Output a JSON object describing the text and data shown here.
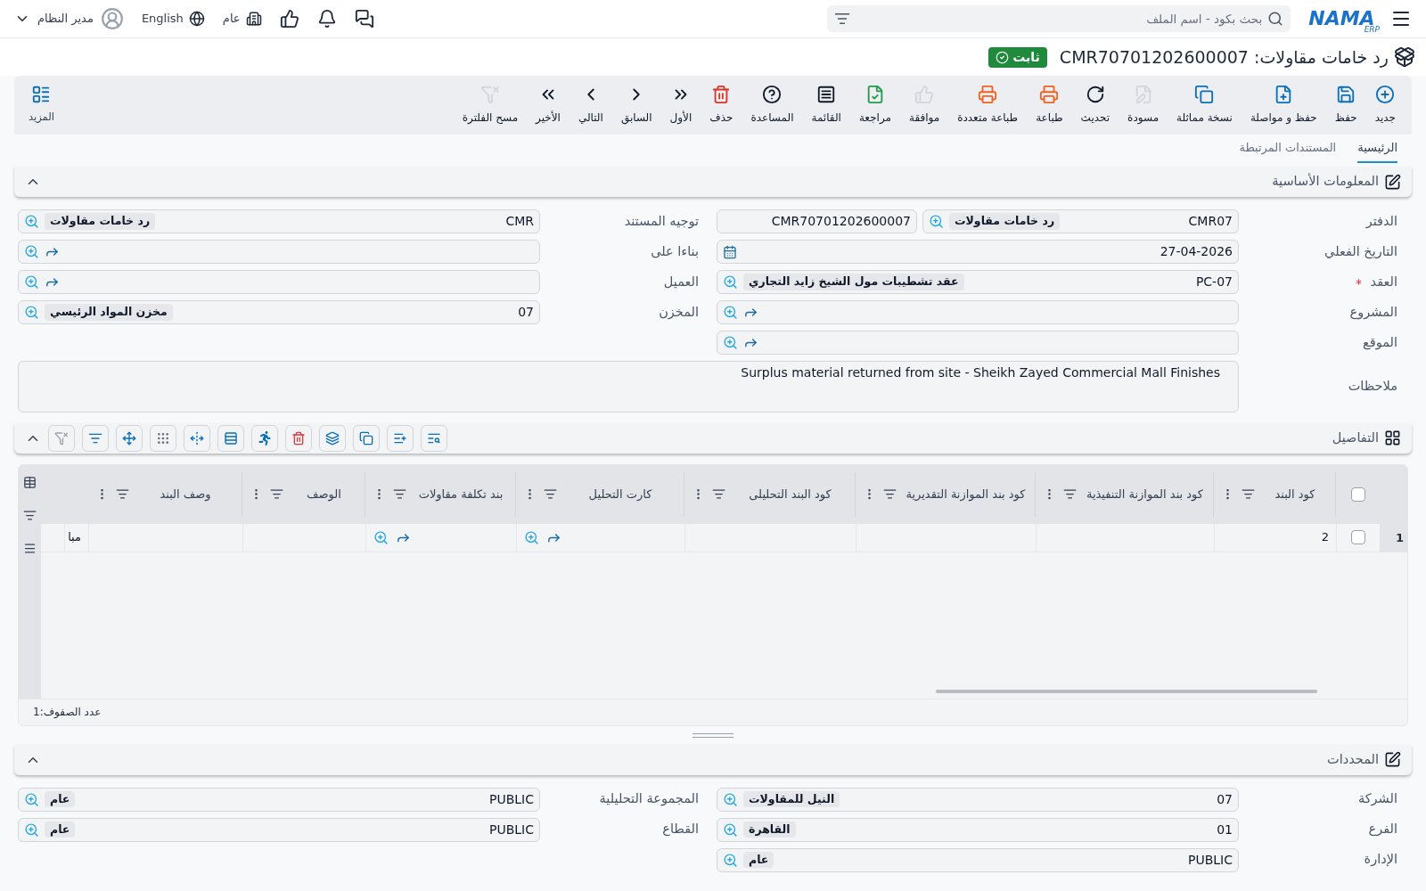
{
  "topbar": {
    "logo": "NAMA",
    "logo_sub": "ERP",
    "search": {
      "placeholder": "بحث بكود - اسم الملف"
    },
    "scope": "عام",
    "language": "English",
    "user": "مدير النظام"
  },
  "document": {
    "title": "رد خامات مقاولات: CMR70701202600007",
    "status": {
      "label": "ثابت",
      "kind": "posted"
    }
  },
  "toolbar": [
    {
      "label": "جديد",
      "disabled": false
    },
    {
      "label": "حفظ",
      "disabled": false
    },
    {
      "label": "حفظ و مواصلة",
      "disabled": false
    },
    {
      "label": "نسخة مماثلة",
      "disabled": false
    },
    {
      "label": "مسودة",
      "disabled": true
    },
    {
      "label": "تحديث",
      "disabled": false
    },
    {
      "label": "طباعة",
      "disabled": false
    },
    {
      "label": "طباعة متعددة",
      "disabled": false
    },
    {
      "label": "موافقة",
      "disabled": true
    },
    {
      "label": "مراجعة",
      "disabled": false
    },
    {
      "label": "القائمة",
      "disabled": false
    },
    {
      "label": "المساعدة",
      "disabled": false
    },
    {
      "label": "حذف",
      "disabled": false
    },
    {
      "label": "الأول",
      "disabled": false
    },
    {
      "label": "السابق",
      "disabled": false
    },
    {
      "label": "التالي",
      "disabled": false
    },
    {
      "label": "الأخير",
      "disabled": false
    },
    {
      "label": "مسح الفلترة",
      "disabled": true
    }
  ],
  "more": "المزيد",
  "tabs": [
    {
      "label": "الرئيسية",
      "selected": true
    },
    {
      "label": "المستندات المرتبطة",
      "selected": false
    }
  ],
  "basic": {
    "title": "المعلومات الأساسية",
    "expanded": true,
    "right_fields": [
      {
        "label": "الدفتر",
        "kind": "book",
        "required": false,
        "value": "CMR07",
        "tag": "رد خامات مقاولات",
        "number": "CMR70701202600007"
      },
      {
        "label": "التاريخ الفعلي",
        "kind": "date",
        "required": false,
        "value": "27-04-2026"
      },
      {
        "label": "العقد",
        "kind": "lookup",
        "required": true,
        "value": "PC-07",
        "tag": "عقد تشطيبات مول الشيخ زايد التجاري"
      },
      {
        "label": "المشروع",
        "kind": "link",
        "required": false
      },
      {
        "label": "الموقع",
        "kind": "link",
        "required": false
      }
    ],
    "left_fields": [
      {
        "label": "توجيه المستند",
        "kind": "lookup",
        "required": false,
        "value": "CMR",
        "tag": "رد خامات مقاولات"
      },
      {
        "label": "بناءا على",
        "kind": "link",
        "required": false
      },
      {
        "label": "العميل",
        "kind": "link",
        "required": false
      },
      {
        "label": "المخزن",
        "kind": "lookup",
        "required": false,
        "value": "07",
        "tag": "مخزن المواد الرئيسي"
      }
    ],
    "notes": {
      "label": "ملاحظات",
      "value": "Surplus material returned from site - Sheikh Zayed Commercial Mall Finishes"
    }
  },
  "details": {
    "title": "التفاصيل",
    "expanded": true,
    "columns": [
      {
        "kind": "select",
        "checked": false
      },
      {
        "kind": "text",
        "label": "كود البند"
      },
      {
        "kind": "text",
        "label": "كود بند الموازنة التنفيذية"
      },
      {
        "kind": "text",
        "label": "كود بند الموازنة التقديرية"
      },
      {
        "kind": "text",
        "label": "كود البند التحليلى"
      },
      {
        "kind": "text",
        "label": "كارت التحليل"
      },
      {
        "kind": "text",
        "label": "بند تكلفة مقاولات"
      },
      {
        "kind": "text",
        "label": "الوصف"
      },
      {
        "kind": "text",
        "label": "وصف البند"
      },
      {
        "kind": "blank"
      }
    ],
    "rows": [
      {
        "number": "1",
        "checked": false,
        "cells": [
          {
            "kind": "select"
          },
          {
            "kind": "text",
            "value": "2"
          },
          {
            "kind": "empty"
          },
          {
            "kind": "empty"
          },
          {
            "kind": "empty"
          },
          {
            "kind": "link"
          },
          {
            "kind": "link"
          },
          {
            "kind": "empty"
          },
          {
            "kind": "empty"
          },
          {
            "kind": "text",
            "value": "مبا"
          }
        ]
      }
    ],
    "row_count": "عدد الصفوف:1"
  },
  "dimensions": {
    "title": "المحددات",
    "expanded": true,
    "right_fields": [
      {
        "label": "الشركة",
        "kind": "lookup",
        "required": false,
        "value": "07",
        "tag": "النيل للمقاولات"
      },
      {
        "label": "الفرع",
        "kind": "lookup",
        "required": false,
        "value": "01",
        "tag": "القاهرة"
      },
      {
        "label": "الإدارة",
        "kind": "lookup",
        "required": false,
        "value": "PUBLIC",
        "tag": "عام"
      }
    ],
    "left_fields": [
      {
        "label": "المجموعة التحليلية",
        "kind": "lookup",
        "required": false,
        "value": "PUBLIC",
        "tag": "عام"
      },
      {
        "label": "القطاع",
        "kind": "lookup",
        "required": false,
        "value": "PUBLIC",
        "tag": "عام"
      }
    ]
  }
}
